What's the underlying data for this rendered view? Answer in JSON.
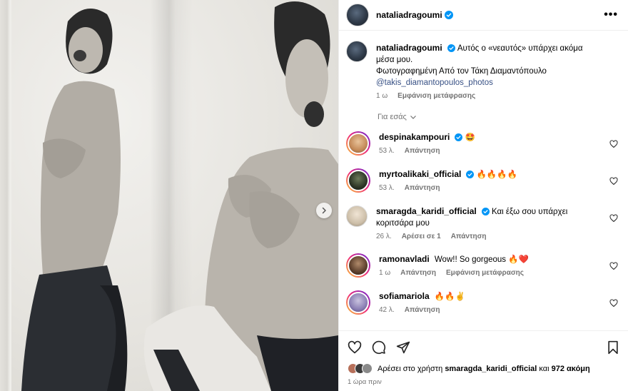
{
  "post": {
    "username": "nataliadragoumi",
    "more_label": "•••",
    "caption_line1": "Αυτός ο «νεαυτός» υπάρχει ακόμα μέσα μου.",
    "caption_line2": "Φωτογραφημένη Από τον Τάκη Διαμαντόπουλο",
    "caption_mention": "@takis_diamantopoulos_photos",
    "caption_time": "1 ω",
    "caption_translate": "Εμφάνιση μετάφρασης",
    "for_you": "Για εσάς"
  },
  "comments": [
    {
      "username": "despinakampouri",
      "verified": true,
      "text": "🤩",
      "time": "53 λ.",
      "reply": "Απάντηση",
      "likes_label": "",
      "translate": ""
    },
    {
      "username": "myrtoalikaki_official",
      "verified": true,
      "text": "🔥🔥🔥🔥",
      "time": "53 λ.",
      "reply": "Απάντηση",
      "likes_label": "",
      "translate": ""
    },
    {
      "username": "smaragda_karidi_official",
      "verified": true,
      "text": "Και έξω σου υπάρχει κοριτσάρα μου",
      "time": "26 λ.",
      "reply": "Απάντηση",
      "likes_label": "Αρέσει σε 1",
      "translate": ""
    },
    {
      "username": "ramonavladi",
      "verified": false,
      "text": "Wow!! So gorgeous 🔥❤️",
      "time": "1 ω",
      "reply": "Απάντηση",
      "likes_label": "",
      "translate": "Εμφάνιση μετάφρασης"
    },
    {
      "username": "sofiamariola",
      "verified": false,
      "text": "🔥🔥✌️",
      "time": "42 λ.",
      "reply": "Απάντηση",
      "likes_label": "",
      "translate": ""
    }
  ],
  "footer": {
    "likes_prefix": "Αρέσει στο χρήστη",
    "likes_user": "smaragda_karidi_official",
    "likes_and": "και",
    "likes_count": "972 ακόμη",
    "posted_time": "1 ώρα πριν"
  },
  "icons": {
    "verified": "verified-badge-icon",
    "heart": "heart-icon",
    "comment": "comment-icon",
    "share": "share-icon",
    "bookmark": "bookmark-icon",
    "next": "chevron-right-icon"
  },
  "colors": {
    "verified": "#0095f6",
    "secondary_text": "#737373",
    "link": "#385185"
  }
}
